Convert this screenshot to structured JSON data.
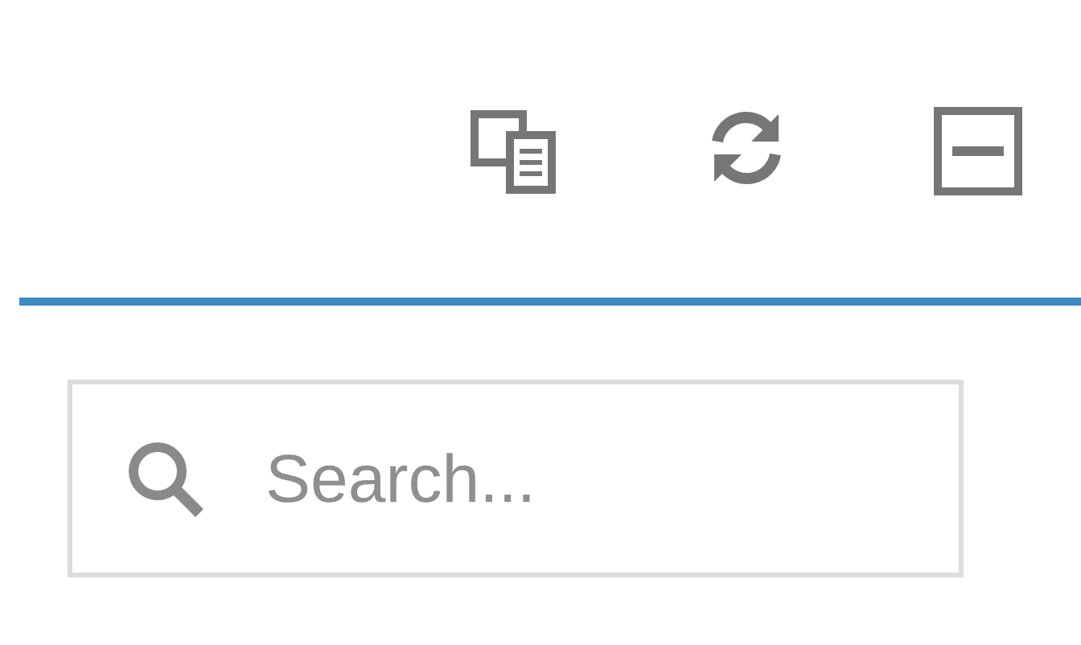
{
  "search": {
    "placeholder": "Search..."
  }
}
